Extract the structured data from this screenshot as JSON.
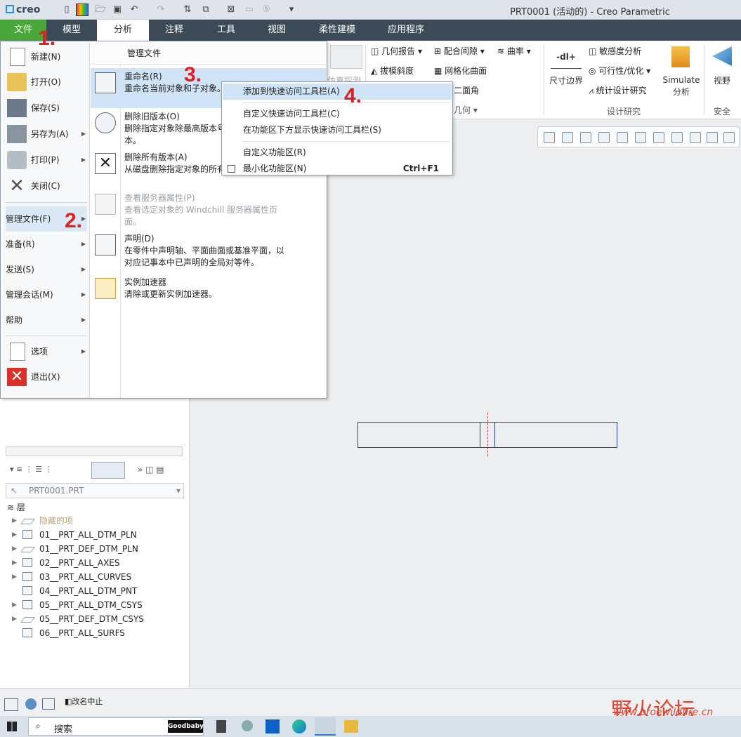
{
  "window": {
    "title": "PRT0001 (活动的) - Creo Parametric",
    "logo": "creo"
  },
  "tabs": [
    "文件",
    "模型",
    "分析",
    "注释",
    "工具",
    "视图",
    "柔性建模",
    "应用程序"
  ],
  "ribbon": {
    "sim_label": "仿真探测",
    "items": [
      "几何报告",
      "配合间隙",
      "曲率",
      "拔模斜度",
      "网格化曲面",
      "二面角",
      "几何"
    ],
    "dim_bound": "尺寸边界",
    "dim_icon_text": "-dl+",
    "study": [
      "敏感度分析",
      "可行性/优化",
      "统计设计研究"
    ],
    "simulate": "Simulate\n分析",
    "group_design": "设计研究",
    "view": "视野",
    "group_safe": "安全"
  },
  "file_menu": {
    "left": [
      {
        "label": "新建(N)",
        "key": "N"
      },
      {
        "label": "打开(O)"
      },
      {
        "label": "保存(S)"
      },
      {
        "label": "另存为(A)",
        "sub": true
      },
      {
        "label": "打印(P)",
        "sub": true
      },
      {
        "label": "关闭(C)"
      }
    ],
    "left2": [
      "管理文件(F)",
      "准备(R)",
      "发送(S)",
      "管理会话(M)",
      "帮助"
    ],
    "left3": [
      "选项",
      "退出(X)"
    ],
    "right_header": "管理文件",
    "right": [
      {
        "title": "重命名(R)",
        "desc": "重命名当前对象和子对象。"
      },
      {
        "title": "删除旧版本(O)",
        "desc": "删除指定对象除最高版本号",
        "desc2": "本。"
      },
      {
        "title": "删除所有版本(A)",
        "desc": "从磁盘删除指定对象的所有"
      },
      {
        "title": "查看服务器属性(P)",
        "desc": "查看选定对象的 Windchill 服务器属性页",
        "desc2": "面。"
      },
      {
        "title": "声明(D)",
        "desc": "在零件中声明轴、平面曲面或基准平面，以",
        "desc2": "对应记事本中已声明的全局对等件。"
      },
      {
        "title": "实例加速器",
        "desc": "清除或更新实例加速器。"
      }
    ]
  },
  "context_menu": {
    "items": [
      "添加到快速访问工具栏(A)",
      "自定义快速访问工具栏(C)",
      "在功能区下方显示快速访问工具栏(S)",
      "自定义功能区(R)",
      "最小化功能区(N)"
    ],
    "shortcut": "Ctrl+F1"
  },
  "steps": [
    "1.",
    "2.",
    "3.",
    "4."
  ],
  "model_tree": {
    "selector": "PRT0001.PRT",
    "root": "层",
    "layers": [
      {
        "name": "隐藏的项",
        "arrow": true,
        "dim": true
      },
      {
        "name": "01__PRT_ALL_DTM_PLN",
        "arrow": true
      },
      {
        "name": "01__PRT_DEF_DTM_PLN",
        "arrow": true
      },
      {
        "name": "02__PRT_ALL_AXES",
        "arrow": true
      },
      {
        "name": "03__PRT_ALL_CURVES",
        "arrow": true
      },
      {
        "name": "04__PRT_ALL_DTM_PNT",
        "arrow": false
      },
      {
        "name": "05__PRT_ALL_DTM_CSYS",
        "arrow": true
      },
      {
        "name": "05__PRT_DEF_DTM_CSYS",
        "arrow": true
      },
      {
        "name": "06__PRT_ALL_SURFS",
        "arrow": false
      }
    ]
  },
  "status": {
    "message": "改名中止"
  },
  "taskbar": {
    "search": "搜索",
    "app_badge": "Goodbaby"
  },
  "watermark": {
    "cn": "野火论坛",
    "url": "www.proewildfire.cn"
  },
  "colors": {
    "file_tab": "#4aa63a",
    "tabbar": "#3c4a57",
    "highlight": "#cfe4f7",
    "step": "#e02020"
  }
}
